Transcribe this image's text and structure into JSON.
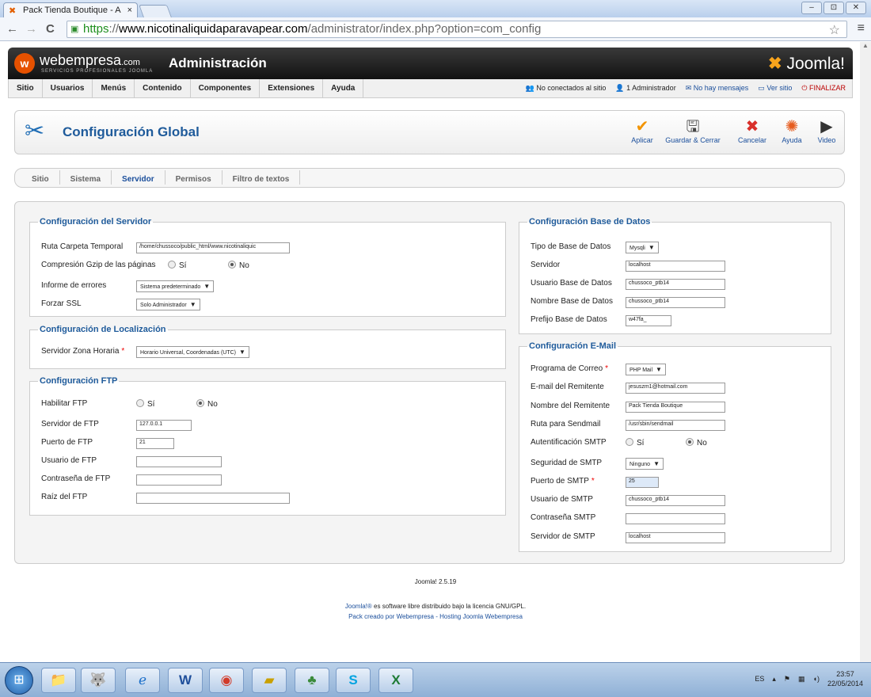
{
  "browser": {
    "tab_title": "Pack Tienda Boutique - A",
    "tab_close": "×",
    "url_https": "https",
    "url_host": "www.nicotinaliquidaparavapear.com",
    "url_path": "/administrator/index.php?option=com_config",
    "url_prefix": "://",
    "back": "←",
    "forward": "→",
    "reload": "C",
    "min": "–",
    "max": "⊡",
    "close": "✕"
  },
  "header": {
    "logo_text": "webempresa",
    "logo_dom": ".com",
    "logo_sub": "SERVICIOS PROFESIONALES JOOMLA",
    "title": "Administración",
    "joomla": "Joomla!"
  },
  "menu": {
    "items": [
      "Sitio",
      "Usuarios",
      "Menús",
      "Contenido",
      "Componentes",
      "Extensiones",
      "Ayuda"
    ]
  },
  "status": {
    "not_connected": "No conectados al sitio",
    "admins": "1 Administrador",
    "messages": "No hay mensajes",
    "view_site": "Ver sitio",
    "logout": "FINALIZAR"
  },
  "page": {
    "title": "Configuración Global"
  },
  "toolbar": {
    "apply": "Aplicar",
    "save_close": "Guardar & Cerrar",
    "cancel": "Cancelar",
    "help": "Ayuda",
    "video": "Video"
  },
  "tabs": [
    "Sitio",
    "Sistema",
    "Servidor",
    "Permisos",
    "Filtro de textos"
  ],
  "server": {
    "legend": "Configuración del Servidor",
    "tmp_label": "Ruta Carpeta Temporal",
    "tmp_value": "/home/chussoco/public_html/www.nicotinaliquic",
    "gzip_label": "Compresión Gzip de las páginas",
    "yes": "Sí",
    "no": "No",
    "errors_label": "Informe de errores",
    "errors_value": "Sistema predeterminado",
    "ssl_label": "Forzar SSL",
    "ssl_value": "Solo Administrador"
  },
  "locale": {
    "legend": "Configuración de Localización",
    "tz_label": "Servidor Zona Horaria",
    "tz_value": "Horario Universal, Coordenadas (UTC)"
  },
  "ftp": {
    "legend": "Configuración FTP",
    "enable_label": "Habilitar FTP",
    "host_label": "Servidor de FTP",
    "host_value": "127.0.0.1",
    "port_label": "Puerto de FTP",
    "port_value": "21",
    "user_label": "Usuario de FTP",
    "pass_label": "Contraseña de FTP",
    "root_label": "Raíz del FTP"
  },
  "db": {
    "legend": "Configuración Base de Datos",
    "type_label": "Tipo de Base de Datos",
    "type_value": "Mysqli",
    "host_label": "Servidor",
    "host_value": "localhost",
    "user_label": "Usuario Base de Datos",
    "user_value": "chussoco_ptb14",
    "name_label": "Nombre Base de Datos",
    "name_value": "chussoco_ptb14",
    "prefix_label": "Prefijo Base de Datos",
    "prefix_value": "w47fa_"
  },
  "mail": {
    "legend": "Configuración E-Mail",
    "mailer_label": "Programa de Correo",
    "mailer_value": "PHP Mail",
    "from_label": "E-mail del Remitente",
    "from_value": "jesuszm1@hotmail.com",
    "fromname_label": "Nombre del Remitente",
    "fromname_value": "Pack Tienda Boutique",
    "sendmail_label": "Ruta para Sendmail",
    "sendmail_value": "/usr/sbin/sendmail",
    "smtpauth_label": "Autentificación SMTP",
    "smtpsec_label": "Seguridad de SMTP",
    "smtpsec_value": "Ninguno",
    "smtpport_label": "Puerto de SMTP",
    "smtpport_value": "25",
    "smtpuser_label": "Usuario de SMTP",
    "smtpuser_value": "chussoco_ptb14",
    "smtppass_label": "Contraseña SMTP",
    "smtphost_label": "Servidor de SMTP",
    "smtphost_value": "localhost"
  },
  "footer": {
    "version": "Joomla! 2.5.19",
    "license_link": "Joomla!®",
    "license_text": " es software libre distribuido bajo la licencia GNU/GPL.",
    "credit1": "Pack creado por Webempresa",
    "credit_sep": " - ",
    "credit2": "Hosting Joomla Webempresa"
  },
  "taskbar": {
    "lang": "ES",
    "time": "23:57",
    "date": "22/05/2014"
  }
}
